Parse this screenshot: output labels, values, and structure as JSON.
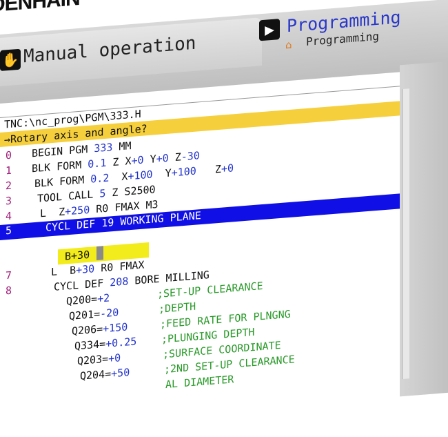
{
  "brand": {
    "logo_text": "DENHAIN"
  },
  "header": {
    "manual_tab_label": "Manual operation",
    "programming_title": "Programming",
    "programming_subtitle": "Programming"
  },
  "editor": {
    "path": "TNC:\\nc_prog\\PGM\\333.H",
    "prompt": "→Rotary axis and angle?",
    "input_value": "B+30",
    "lines": [
      {
        "num": "0",
        "parts": [
          [
            "BEGIN PGM ",
            ""
          ],
          [
            "333",
            "blu"
          ],
          [
            " MM",
            ""
          ]
        ]
      },
      {
        "num": "1",
        "parts": [
          [
            "BLK FORM ",
            ""
          ],
          [
            "0.1",
            "blu"
          ],
          [
            " Z X",
            ""
          ],
          [
            "+0",
            "blu"
          ],
          [
            " Y",
            ""
          ],
          [
            "+0",
            "blu"
          ],
          [
            " Z",
            ""
          ],
          [
            "-30",
            "blu"
          ]
        ]
      },
      {
        "num": "2",
        "parts": [
          [
            "BLK FORM ",
            ""
          ],
          [
            "0.2",
            "blu"
          ],
          [
            "  X",
            ""
          ],
          [
            "+100",
            "blu"
          ],
          [
            "  Y",
            ""
          ],
          [
            "+100",
            "blu"
          ],
          [
            "   Z",
            ""
          ],
          [
            "+0",
            "blu"
          ]
        ]
      },
      {
        "num": "3",
        "parts": [
          [
            "TOOL CALL ",
            ""
          ],
          [
            "5",
            "blu"
          ],
          [
            " Z S2500",
            ""
          ]
        ]
      },
      {
        "num": "4",
        "parts": [
          [
            "L  Z",
            ""
          ],
          [
            "+250",
            "blu"
          ],
          [
            " R0 FMAX M3",
            ""
          ]
        ]
      },
      {
        "num": "5",
        "parts": [
          [
            "CYCL DEF 19 WORKING PLANE",
            ""
          ]
        ]
      },
      {
        "num": "7",
        "parts": [
          [
            "L  B",
            ""
          ],
          [
            "+30",
            "blu"
          ],
          [
            " R0 FMAX",
            ""
          ]
        ]
      },
      {
        "num": "8",
        "parts": [
          [
            "CYCL DEF ",
            ""
          ],
          [
            "208",
            "blu"
          ],
          [
            " BORE MILLING",
            ""
          ]
        ]
      },
      {
        "num": "",
        "parts": [
          [
            "Q200=",
            ""
          ],
          [
            "+2",
            "blu"
          ]
        ],
        "comment": ";SET-UP CLEARANCE"
      },
      {
        "num": "",
        "parts": [
          [
            "Q201=",
            ""
          ],
          [
            "-20",
            "blu"
          ]
        ],
        "comment": ";DEPTH"
      },
      {
        "num": "",
        "parts": [
          [
            "Q206=",
            ""
          ],
          [
            "+150",
            "blu"
          ]
        ],
        "comment": ";FEED RATE FOR PLNGNG"
      },
      {
        "num": "",
        "parts": [
          [
            "Q334=",
            ""
          ],
          [
            "+0.25",
            "blu"
          ]
        ],
        "comment": ";PLUNGING DEPTH"
      },
      {
        "num": "",
        "parts": [
          [
            "Q203=",
            ""
          ],
          [
            "+0",
            "blu"
          ]
        ],
        "comment": ";SURFACE COORDINATE"
      },
      {
        "num": "",
        "parts": [
          [
            "Q204=",
            ""
          ],
          [
            "+50",
            "blu"
          ]
        ],
        "comment": ";2ND SET-UP CLEARANCE"
      },
      {
        "num": "",
        "parts": [],
        "comment": "AL DIAMETER"
      }
    ],
    "active_line_index": 5
  },
  "icons": {
    "manual_tab": "hand-icon",
    "programming_tab": "program-icon",
    "home": "home-icon"
  },
  "colors": {
    "prompt_bar": "#f5cf3c",
    "active_line": "#1010e6",
    "input_field": "#f2ec1c",
    "numbers": "#2233cc",
    "comments": "#2a9a2a",
    "line_numbers": "#a0207a",
    "programming_title": "#2a38c8"
  }
}
